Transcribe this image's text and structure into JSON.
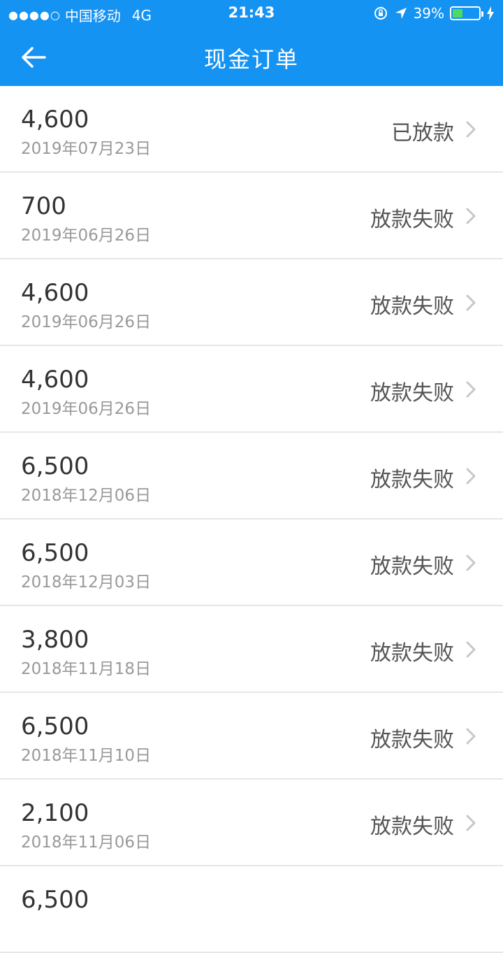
{
  "status_bar": {
    "signal_dots": "●●●●○",
    "carrier": "中国移动",
    "network": "4G",
    "time": "21:43",
    "battery_percent": "39%",
    "battery_level": 0.39
  },
  "nav": {
    "title": "现金订单",
    "back_icon": "arrow-left-icon"
  },
  "orders": [
    {
      "amount": "4,600",
      "date": "2019年07月23日",
      "status": "已放款"
    },
    {
      "amount": "700",
      "date": "2019年06月26日",
      "status": "放款失败"
    },
    {
      "amount": "4,600",
      "date": "2019年06月26日",
      "status": "放款失败"
    },
    {
      "amount": "4,600",
      "date": "2019年06月26日",
      "status": "放款失败"
    },
    {
      "amount": "6,500",
      "date": "2018年12月06日",
      "status": "放款失败"
    },
    {
      "amount": "6,500",
      "date": "2018年12月03日",
      "status": "放款失败"
    },
    {
      "amount": "3,800",
      "date": "2018年11月18日",
      "status": "放款失败"
    },
    {
      "amount": "6,500",
      "date": "2018年11月10日",
      "status": "放款失败"
    },
    {
      "amount": "2,100",
      "date": "2018年11月06日",
      "status": "放款失败"
    },
    {
      "amount": "6,500",
      "date": "",
      "status": ""
    }
  ],
  "colors": {
    "header_bg": "#1493f3",
    "battery_fill": "#4cd964"
  }
}
